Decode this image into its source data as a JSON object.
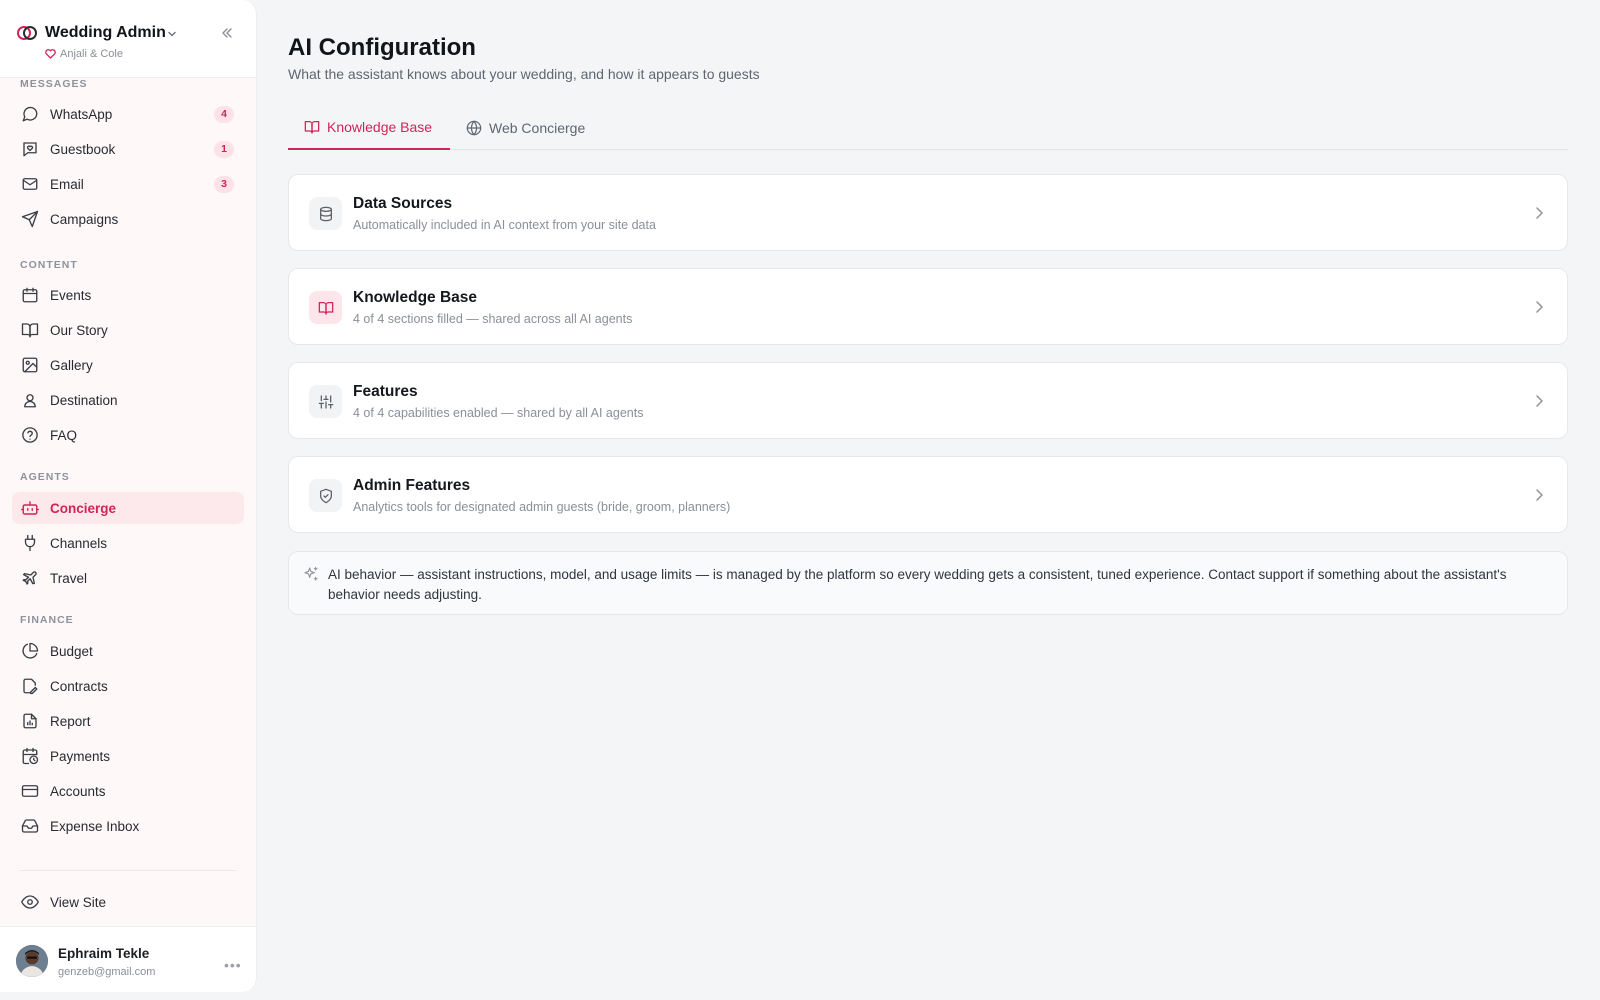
{
  "sidebar": {
    "app_title": "Wedding Admin",
    "couple": "Anjali & Cole",
    "sections": {
      "messages": "MESSAGES",
      "content": "CONTENT",
      "agents": "AGENTS",
      "finance": "FINANCE"
    },
    "items": {
      "whatsapp": {
        "label": "WhatsApp",
        "badge": "4"
      },
      "guestbook": {
        "label": "Guestbook",
        "badge": "1"
      },
      "email": {
        "label": "Email",
        "badge": "3"
      },
      "campaigns": {
        "label": "Campaigns"
      },
      "events": {
        "label": "Events"
      },
      "our_story": {
        "label": "Our Story"
      },
      "gallery": {
        "label": "Gallery"
      },
      "destination": {
        "label": "Destination"
      },
      "faq": {
        "label": "FAQ"
      },
      "concierge": {
        "label": "Concierge",
        "active": true
      },
      "channels": {
        "label": "Channels"
      },
      "travel": {
        "label": "Travel"
      },
      "budget": {
        "label": "Budget"
      },
      "contracts": {
        "label": "Contracts"
      },
      "report": {
        "label": "Report"
      },
      "payments": {
        "label": "Payments"
      },
      "accounts": {
        "label": "Accounts"
      },
      "expense_inbox": {
        "label": "Expense Inbox"
      },
      "view_site": {
        "label": "View Site"
      }
    },
    "user": {
      "name": "Ephraim Tekle",
      "email": "genzeb@gmail.com"
    }
  },
  "main": {
    "title": "AI Configuration",
    "subtitle": "What the assistant knows about your wedding, and how it appears to guests",
    "tabs": [
      {
        "label": "Knowledge Base",
        "active": true,
        "icon": "book-open-icon"
      },
      {
        "label": "Web Concierge",
        "active": false,
        "icon": "globe-icon"
      }
    ],
    "cards": [
      {
        "title": "Data Sources",
        "description": "Automatically included in AI context from your site data",
        "icon": "database-icon"
      },
      {
        "title": "Knowledge Base",
        "description": "4 of 4 sections filled — shared across all AI agents",
        "icon": "book-open-icon"
      },
      {
        "title": "Features",
        "description": "4 of 4 capabilities enabled — shared by all AI agents",
        "icon": "sliders-icon"
      },
      {
        "title": "Admin Features",
        "description": "Analytics tools for designated admin guests (bride, groom, planners)",
        "icon": "shield-check-icon"
      }
    ],
    "note": "AI behavior — assistant instructions, model, and usage limits — is managed by the platform so every wedding gets a consistent, tuned experience. Contact support if something about the assistant's behavior needs adjusting."
  },
  "colors": {
    "accent": "#d22456",
    "accent_bg": "#fde8ec",
    "sidebar_bg": "#fff8f9",
    "page_bg": "#f4f5f7"
  }
}
